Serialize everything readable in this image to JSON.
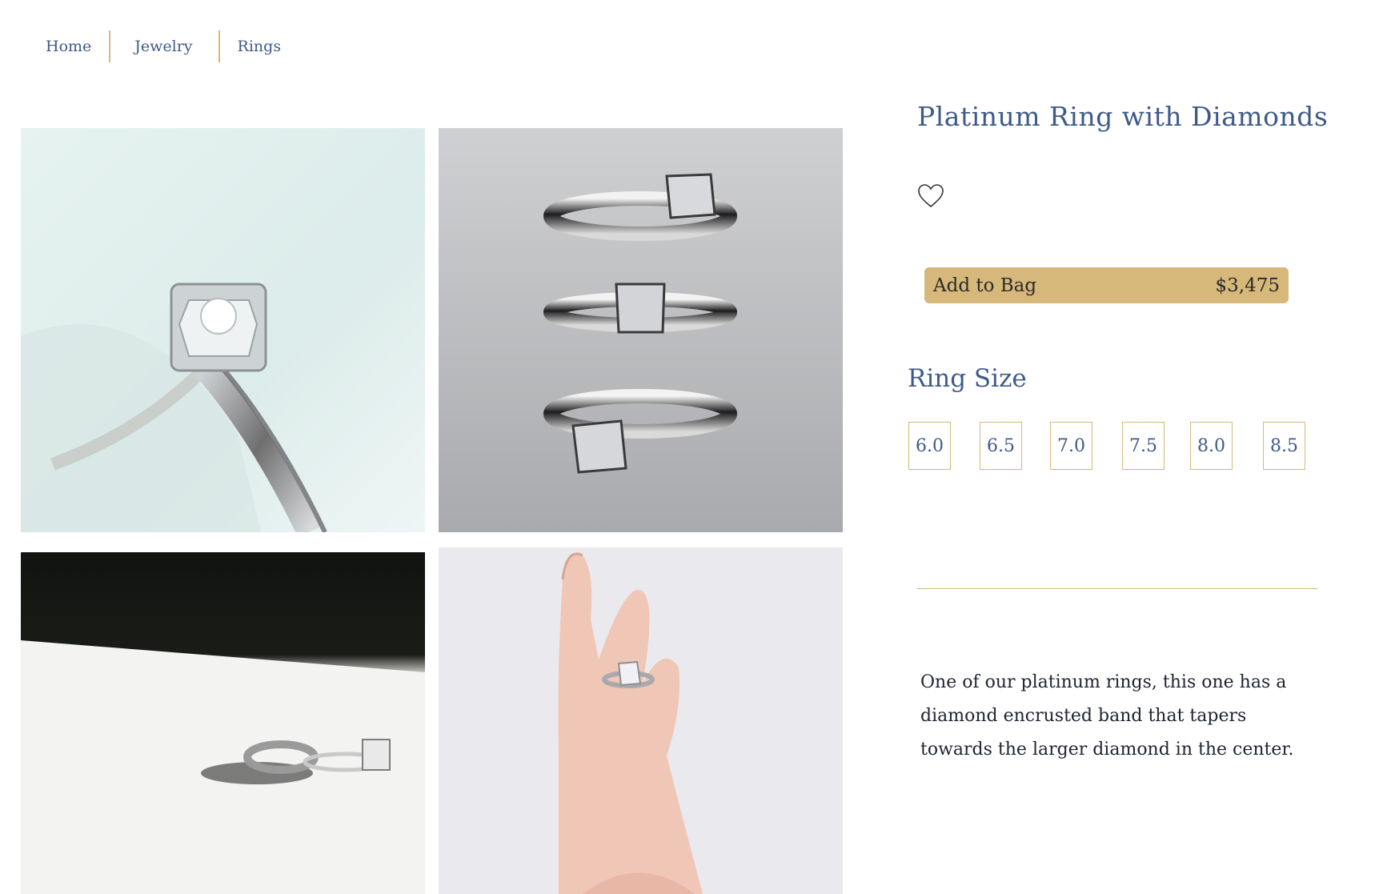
{
  "breadcrumb": {
    "items": [
      {
        "label": "Home"
      },
      {
        "label": "Jewelry"
      },
      {
        "label": "Rings"
      }
    ]
  },
  "gallery": {
    "images": [
      {
        "subject": "diamond-ring-closeup"
      },
      {
        "subject": "three-princess-cut-rings"
      },
      {
        "subject": "wedding-band-and-engagement-ring"
      },
      {
        "subject": "hand-wearing-ring"
      }
    ]
  },
  "product": {
    "title": "Platinum Ring with Diamonds",
    "wishlist_icon": "heart-outline-icon",
    "add_to_bag_label": "Add to Bag",
    "price": "$3,475",
    "size_label": "Ring Size",
    "sizes": [
      "6.0",
      "6.5",
      "7.0",
      "7.5",
      "8.0",
      "8.5"
    ],
    "description": "One of our platinum rings, this one has a diamond encrusted band that tapers towards the larger diamond in the center."
  },
  "colors": {
    "accent_gold": "#d6b87b",
    "text_blue": "#3f5a8a",
    "body_text": "#1f2433"
  }
}
